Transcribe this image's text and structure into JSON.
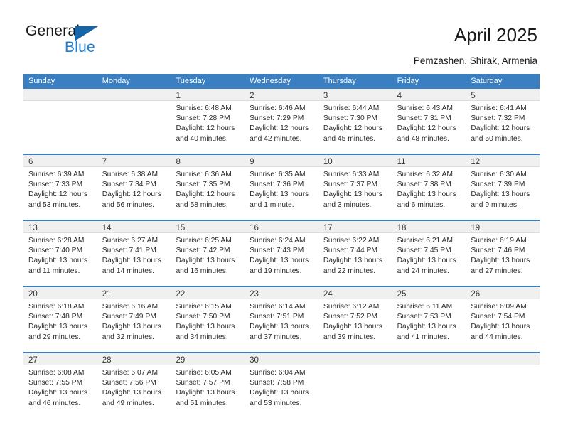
{
  "brand": {
    "name_dark": "General",
    "name_blue": "Blue",
    "logo_icon": "triangle-flag-icon",
    "dark_color": "#1a1a1a",
    "blue_color": "#1f7fd0",
    "triangle_color": "#1565a8"
  },
  "header": {
    "title": "April 2025",
    "subtitle": "Pemzashen, Shirak, Armenia"
  },
  "theme": {
    "header_row_bg": "#3a7fc1",
    "header_row_text": "#ffffff",
    "daynum_bar_bg": "#f0f0f0",
    "cell_bg": "#ffffff",
    "week_divider": "#3a7fc1"
  },
  "weekdays": [
    "Sunday",
    "Monday",
    "Tuesday",
    "Wednesday",
    "Thursday",
    "Friday",
    "Saturday"
  ],
  "weeks": [
    [
      {
        "day": "",
        "lines": []
      },
      {
        "day": "",
        "lines": []
      },
      {
        "day": "1",
        "lines": [
          "Sunrise: 6:48 AM",
          "Sunset: 7:28 PM",
          "Daylight: 12 hours",
          "and 40 minutes."
        ]
      },
      {
        "day": "2",
        "lines": [
          "Sunrise: 6:46 AM",
          "Sunset: 7:29 PM",
          "Daylight: 12 hours",
          "and 42 minutes."
        ]
      },
      {
        "day": "3",
        "lines": [
          "Sunrise: 6:44 AM",
          "Sunset: 7:30 PM",
          "Daylight: 12 hours",
          "and 45 minutes."
        ]
      },
      {
        "day": "4",
        "lines": [
          "Sunrise: 6:43 AM",
          "Sunset: 7:31 PM",
          "Daylight: 12 hours",
          "and 48 minutes."
        ]
      },
      {
        "day": "5",
        "lines": [
          "Sunrise: 6:41 AM",
          "Sunset: 7:32 PM",
          "Daylight: 12 hours",
          "and 50 minutes."
        ]
      }
    ],
    [
      {
        "day": "6",
        "lines": [
          "Sunrise: 6:39 AM",
          "Sunset: 7:33 PM",
          "Daylight: 12 hours",
          "and 53 minutes."
        ]
      },
      {
        "day": "7",
        "lines": [
          "Sunrise: 6:38 AM",
          "Sunset: 7:34 PM",
          "Daylight: 12 hours",
          "and 56 minutes."
        ]
      },
      {
        "day": "8",
        "lines": [
          "Sunrise: 6:36 AM",
          "Sunset: 7:35 PM",
          "Daylight: 12 hours",
          "and 58 minutes."
        ]
      },
      {
        "day": "9",
        "lines": [
          "Sunrise: 6:35 AM",
          "Sunset: 7:36 PM",
          "Daylight: 13 hours",
          "and 1 minute."
        ]
      },
      {
        "day": "10",
        "lines": [
          "Sunrise: 6:33 AM",
          "Sunset: 7:37 PM",
          "Daylight: 13 hours",
          "and 3 minutes."
        ]
      },
      {
        "day": "11",
        "lines": [
          "Sunrise: 6:32 AM",
          "Sunset: 7:38 PM",
          "Daylight: 13 hours",
          "and 6 minutes."
        ]
      },
      {
        "day": "12",
        "lines": [
          "Sunrise: 6:30 AM",
          "Sunset: 7:39 PM",
          "Daylight: 13 hours",
          "and 9 minutes."
        ]
      }
    ],
    [
      {
        "day": "13",
        "lines": [
          "Sunrise: 6:28 AM",
          "Sunset: 7:40 PM",
          "Daylight: 13 hours",
          "and 11 minutes."
        ]
      },
      {
        "day": "14",
        "lines": [
          "Sunrise: 6:27 AM",
          "Sunset: 7:41 PM",
          "Daylight: 13 hours",
          "and 14 minutes."
        ]
      },
      {
        "day": "15",
        "lines": [
          "Sunrise: 6:25 AM",
          "Sunset: 7:42 PM",
          "Daylight: 13 hours",
          "and 16 minutes."
        ]
      },
      {
        "day": "16",
        "lines": [
          "Sunrise: 6:24 AM",
          "Sunset: 7:43 PM",
          "Daylight: 13 hours",
          "and 19 minutes."
        ]
      },
      {
        "day": "17",
        "lines": [
          "Sunrise: 6:22 AM",
          "Sunset: 7:44 PM",
          "Daylight: 13 hours",
          "and 22 minutes."
        ]
      },
      {
        "day": "18",
        "lines": [
          "Sunrise: 6:21 AM",
          "Sunset: 7:45 PM",
          "Daylight: 13 hours",
          "and 24 minutes."
        ]
      },
      {
        "day": "19",
        "lines": [
          "Sunrise: 6:19 AM",
          "Sunset: 7:46 PM",
          "Daylight: 13 hours",
          "and 27 minutes."
        ]
      }
    ],
    [
      {
        "day": "20",
        "lines": [
          "Sunrise: 6:18 AM",
          "Sunset: 7:48 PM",
          "Daylight: 13 hours",
          "and 29 minutes."
        ]
      },
      {
        "day": "21",
        "lines": [
          "Sunrise: 6:16 AM",
          "Sunset: 7:49 PM",
          "Daylight: 13 hours",
          "and 32 minutes."
        ]
      },
      {
        "day": "22",
        "lines": [
          "Sunrise: 6:15 AM",
          "Sunset: 7:50 PM",
          "Daylight: 13 hours",
          "and 34 minutes."
        ]
      },
      {
        "day": "23",
        "lines": [
          "Sunrise: 6:14 AM",
          "Sunset: 7:51 PM",
          "Daylight: 13 hours",
          "and 37 minutes."
        ]
      },
      {
        "day": "24",
        "lines": [
          "Sunrise: 6:12 AM",
          "Sunset: 7:52 PM",
          "Daylight: 13 hours",
          "and 39 minutes."
        ]
      },
      {
        "day": "25",
        "lines": [
          "Sunrise: 6:11 AM",
          "Sunset: 7:53 PM",
          "Daylight: 13 hours",
          "and 41 minutes."
        ]
      },
      {
        "day": "26",
        "lines": [
          "Sunrise: 6:09 AM",
          "Sunset: 7:54 PM",
          "Daylight: 13 hours",
          "and 44 minutes."
        ]
      }
    ],
    [
      {
        "day": "27",
        "lines": [
          "Sunrise: 6:08 AM",
          "Sunset: 7:55 PM",
          "Daylight: 13 hours",
          "and 46 minutes."
        ]
      },
      {
        "day": "28",
        "lines": [
          "Sunrise: 6:07 AM",
          "Sunset: 7:56 PM",
          "Daylight: 13 hours",
          "and 49 minutes."
        ]
      },
      {
        "day": "29",
        "lines": [
          "Sunrise: 6:05 AM",
          "Sunset: 7:57 PM",
          "Daylight: 13 hours",
          "and 51 minutes."
        ]
      },
      {
        "day": "30",
        "lines": [
          "Sunrise: 6:04 AM",
          "Sunset: 7:58 PM",
          "Daylight: 13 hours",
          "and 53 minutes."
        ]
      },
      {
        "day": "",
        "lines": []
      },
      {
        "day": "",
        "lines": []
      },
      {
        "day": "",
        "lines": []
      }
    ]
  ]
}
